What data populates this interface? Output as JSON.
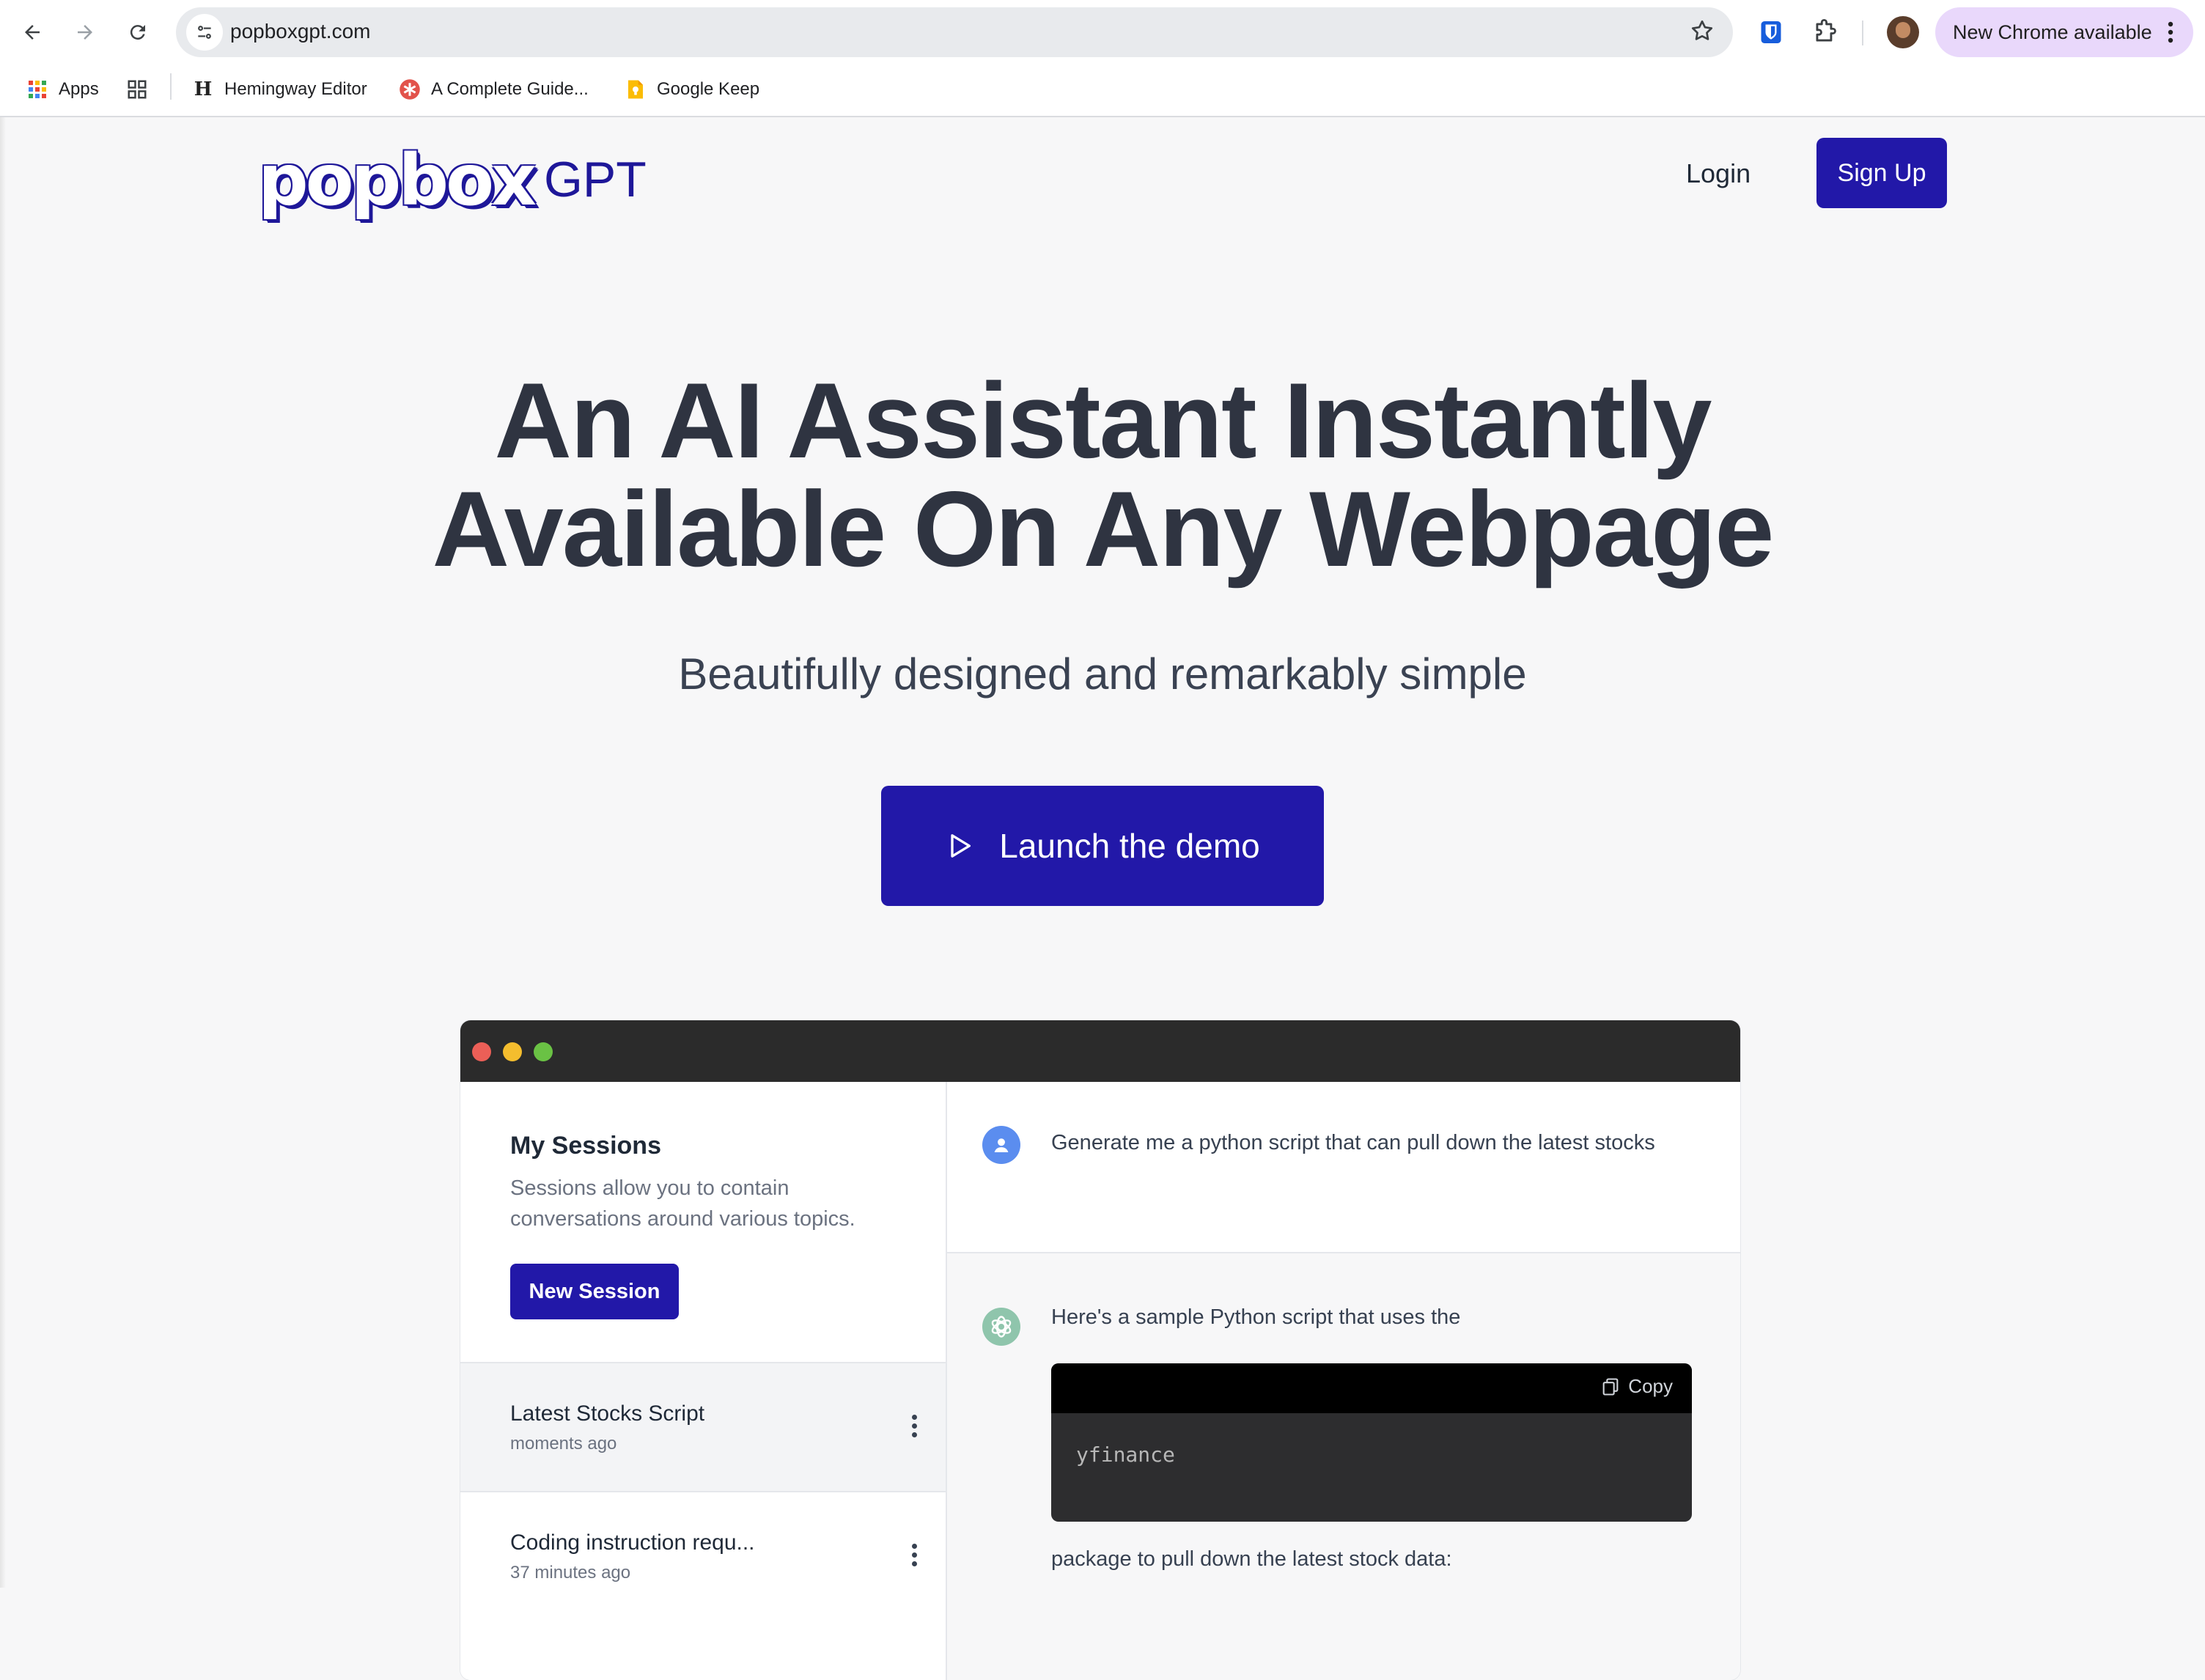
{
  "browser": {
    "url": "popboxgpt.com",
    "update_chip": "New Chrome available",
    "bookmarks": [
      {
        "label": "Apps",
        "icon": "apps-grid-icon"
      },
      {
        "label": "Hemingway Editor",
        "icon": "hemingway-icon"
      },
      {
        "label": "A Complete Guide...",
        "icon": "asterisk-badge-icon"
      },
      {
        "label": "Google Keep",
        "icon": "google-keep-icon"
      }
    ]
  },
  "site": {
    "logo_word": "popbox",
    "logo_suffix": "GPT",
    "nav": {
      "login": "Login",
      "signup": "Sign Up"
    },
    "headline_line1": "An AI Assistant Instantly",
    "headline_line2": "Available On Any Webpage",
    "subhead": "Beautifully designed and remarkably simple",
    "cta": "Launch the demo",
    "brand_color": "#2218a8"
  },
  "demo": {
    "sessions_title": "My Sessions",
    "sessions_desc": "Sessions allow you to contain conversations around various topics.",
    "new_session": "New Session",
    "sessions": [
      {
        "title": "Latest Stocks Script",
        "time": "moments ago"
      },
      {
        "title": "Coding instruction requ...",
        "time": "37 minutes ago"
      }
    ],
    "user_message": "Generate me a python script that can pull down the latest stocks",
    "bot_intro": "Here's a sample Python script that uses the",
    "copy_label": "Copy",
    "code": "yfinance",
    "bot_after": "package to pull down the latest stock data:"
  }
}
